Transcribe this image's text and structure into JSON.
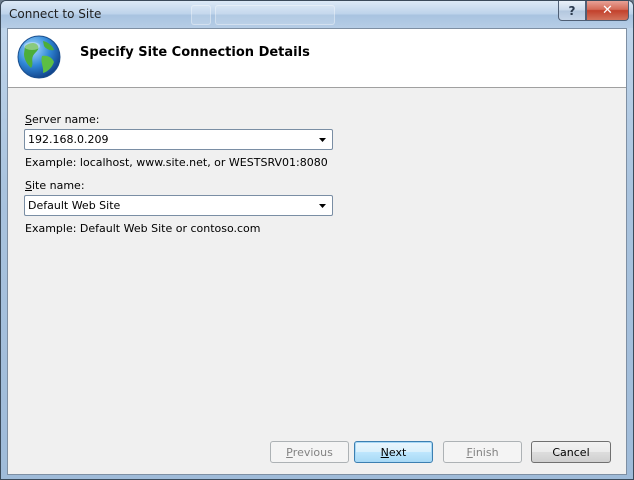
{
  "window": {
    "title": "Connect to Site",
    "help_glyph": "?",
    "close_glyph": "✕"
  },
  "header": {
    "title": "Specify Site Connection Details",
    "icon": "globe-icon"
  },
  "server": {
    "label_access": "S",
    "label_rest": "erver name:",
    "value": "192.168.0.209",
    "example": "Example: localhost, www.site.net, or WESTSRV01:8080"
  },
  "site": {
    "label_access": "S",
    "label_rest": "ite name:",
    "value": "Default Web Site",
    "example": "Example: Default Web Site or contoso.com"
  },
  "buttons": {
    "previous_access": "P",
    "previous_rest": "revious",
    "next_access": "N",
    "next_rest": "ext",
    "finish_access": "F",
    "finish_rest": "inish",
    "cancel": "Cancel"
  },
  "colors": {
    "accent": "#3c7fb1",
    "close": "#c2402b",
    "frame": "#a9c3de"
  }
}
